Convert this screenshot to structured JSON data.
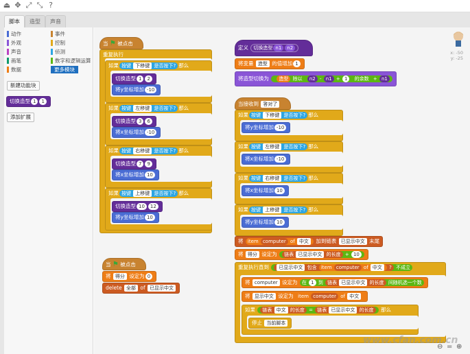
{
  "tabs": [
    "脚本",
    "造型",
    "声音"
  ],
  "categories": [
    {
      "label": "动作",
      "color": "#4a6cd4"
    },
    {
      "label": "外观",
      "color": "#8a55d7"
    },
    {
      "label": "声音",
      "color": "#bb42c3"
    },
    {
      "label": "画笔",
      "color": "#0e9a6c"
    },
    {
      "label": "数据",
      "color": "#ee7d16"
    },
    {
      "label": "事件",
      "color": "#c88330"
    },
    {
      "label": "控制",
      "color": "#e1a91a"
    },
    {
      "label": "侦测",
      "color": "#2ca5e2"
    },
    {
      "label": "数字和逻辑运算",
      "color": "#5cb712"
    },
    {
      "label": "更多模块",
      "color": "#632d99"
    }
  ],
  "sidebar": {
    "make_block": "新建功能块",
    "custom_block": "切换造型",
    "custom_args": [
      "1",
      "1"
    ],
    "add_ext": "添加扩展"
  },
  "sprite": {
    "x": "x: -50",
    "y": "y: -25"
  },
  "watermark": "www.cfan.com.cn",
  "s1": {
    "hat": "当",
    "hat_suffix": "被点击",
    "forever": "重复执行",
    "ifs": [
      {
        "key": "下移键",
        "costume": [
          "1",
          "2"
        ],
        "motion": "将y坐标增加",
        "val": "-10"
      },
      {
        "key": "左移键",
        "costume": [
          "3",
          "6"
        ],
        "motion": "将x坐标增加",
        "val": "-10"
      },
      {
        "key": "右移键",
        "costume": [
          "7",
          "9"
        ],
        "motion": "将x坐标增加",
        "val": "10"
      },
      {
        "key": "上移键",
        "costume": [
          "10",
          "12"
        ],
        "motion": "将y坐标增加",
        "val": "10"
      }
    ],
    "if": "如果",
    "key_pre": "按键",
    "key_post": "是否按下?",
    "then": "那么",
    "sw": "切换造型"
  },
  "s2": {
    "hat": "当",
    "hat_suffix": "被点击",
    "set": "将",
    "var": "得分",
    "set_to": "设定为",
    "set_val": "0",
    "del": "delete",
    "del_opt": "全部",
    "of": "of",
    "list": "已显示中文"
  },
  "s3": {
    "define": "定义",
    "proc": "切换造型",
    "a1": "n1",
    "a2": "n2",
    "change": "将变量",
    "var": "造型",
    "change2": "的值增加",
    "change_val": "1",
    "sw": "将造型切换为",
    "var2": "造型",
    "mod": "除以",
    "m1": "n2",
    "m2": "n1",
    "m3": "1",
    "rem": "的余数",
    "plus": "n1"
  },
  "s4": {
    "hat": "当接收到",
    "msg": "答对了",
    "ifs": [
      {
        "key": "下移键",
        "motion": "将y坐标增加",
        "val": "-10"
      },
      {
        "key": "左移键",
        "motion": "将x坐标增加",
        "val": "-10"
      },
      {
        "key": "右移键",
        "motion": "将x坐标增加",
        "val": "10"
      },
      {
        "key": "上移键",
        "motion": "将y坐标增加",
        "val": "10"
      }
    ],
    "if": "如果",
    "key_pre": "按键",
    "key_post": "是否按下?",
    "then": "那么",
    "add1": "将",
    "add_item": "item",
    "add_item2": "computer",
    "add_of": "of",
    "add_cn": "中文",
    "add_to": "加到链表",
    "add_list": "已显示中文",
    "add_end": "末尾",
    "ch": "将",
    "ch_var": "得分",
    "ch_set": "设定为",
    "ch_len_pre": "链表",
    "ch_len_list": "已显示中文",
    "ch_len_post": "的长度",
    "ch_plus": "10",
    "rep": "重复执行直到",
    "contains": "包含",
    "not": "不成立",
    "set_comp": "将",
    "comp": "computer",
    "set_to": "设定为",
    "in": "在",
    "r1": "1",
    "to": "到",
    "len": "的长度",
    "rnd": "间随机选一个数",
    "set_cn": "将",
    "cn": "显示中文",
    "item": "item",
    "of": "of",
    "if2": "如果",
    "eq": "=",
    "stop": "停止",
    "stop_opt": "当前脚本"
  }
}
